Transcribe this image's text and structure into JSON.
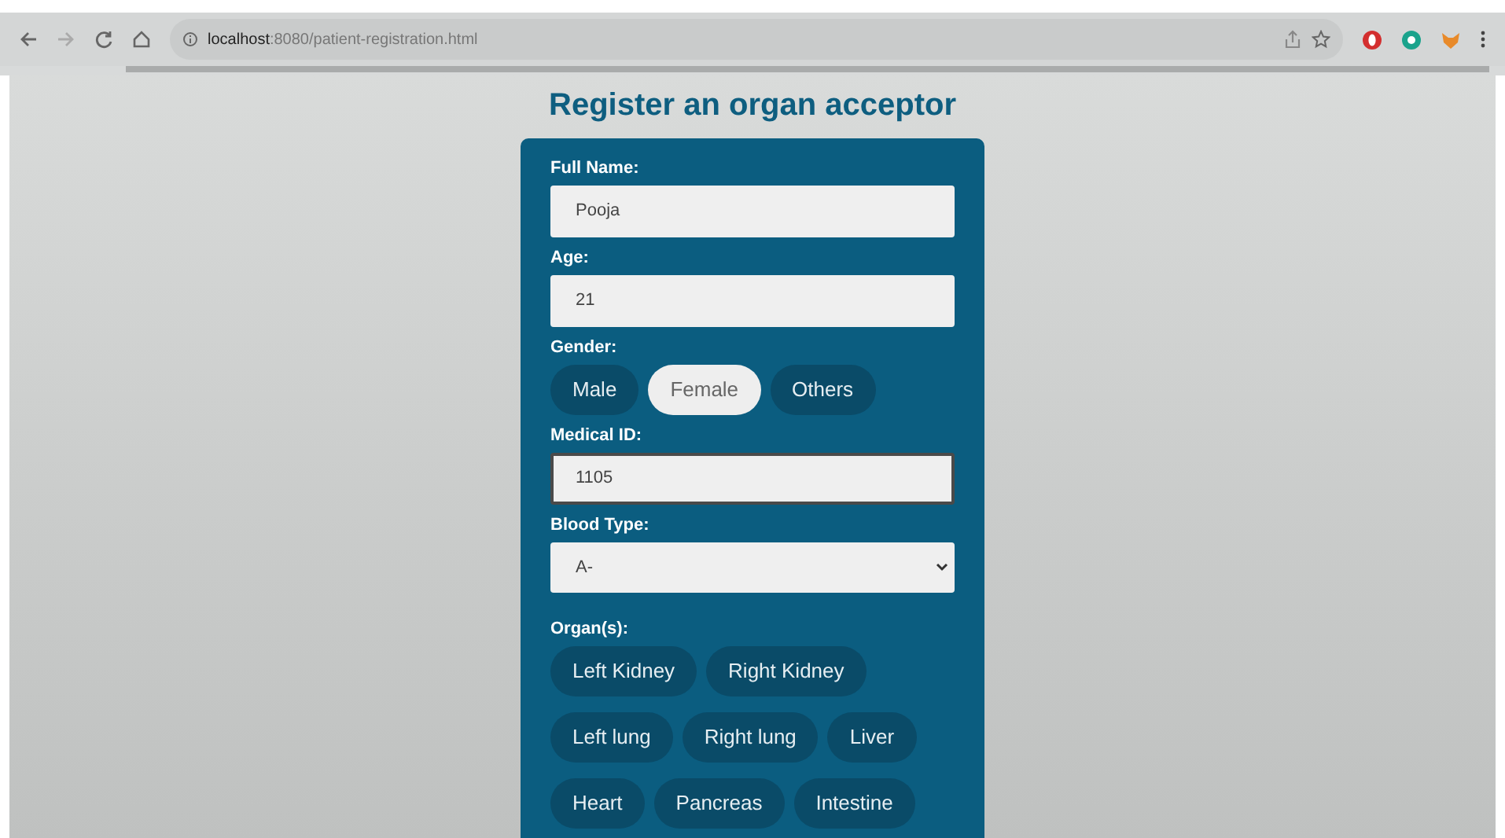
{
  "browser": {
    "url_host": "localhost",
    "url_rest": ":8080/patient-registration.html"
  },
  "page": {
    "title": "Register an organ acceptor"
  },
  "form": {
    "fields": [
      {
        "kind": "text",
        "label": "Full Name:",
        "value": "Pooja",
        "focused": false
      },
      {
        "kind": "text",
        "label": "Age:",
        "value": "21",
        "focused": false
      },
      {
        "kind": "choice",
        "label": "Gender:",
        "options": [
          {
            "label": "Male",
            "selected": false
          },
          {
            "label": "Female",
            "selected": true
          },
          {
            "label": "Others",
            "selected": false
          }
        ]
      },
      {
        "kind": "text",
        "label": "Medical ID:",
        "value": "1105",
        "focused": true
      },
      {
        "kind": "select",
        "label": "Blood Type:",
        "value": "A-"
      },
      {
        "kind": "choice",
        "label": "Organ(s):",
        "options": [
          {
            "label": "Left Kidney",
            "selected": false
          },
          {
            "label": "Right Kidney",
            "selected": false
          },
          {
            "label": "Left lung",
            "selected": false
          },
          {
            "label": "Right lung",
            "selected": false
          },
          {
            "label": "Liver",
            "selected": false
          },
          {
            "label": "Heart",
            "selected": false
          },
          {
            "label": "Pancreas",
            "selected": false
          },
          {
            "label": "Intestine",
            "selected": false
          }
        ]
      }
    ]
  }
}
